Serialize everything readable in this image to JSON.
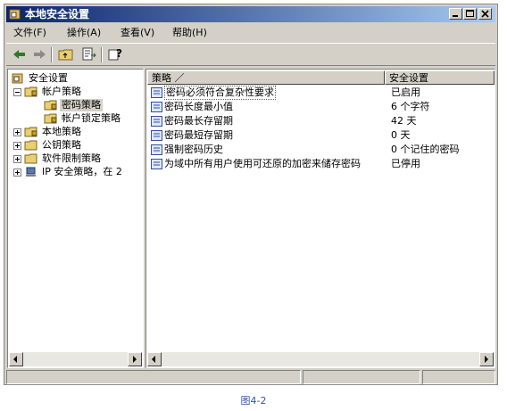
{
  "window": {
    "title": "本地安全设置"
  },
  "menu": [
    {
      "label": "文件(F)"
    },
    {
      "label": "操作(A)"
    },
    {
      "label": "查看(V)"
    },
    {
      "label": "帮助(H)"
    }
  ],
  "tree": [
    {
      "label": "安全设置"
    },
    {
      "label": "帐户策略"
    },
    {
      "label": "密码策略"
    },
    {
      "label": "帐户锁定策略"
    },
    {
      "label": "本地策略"
    },
    {
      "label": "公钥策略"
    },
    {
      "label": "软件限制策略"
    },
    {
      "label": "IP 安全策略，在 2"
    }
  ],
  "table": {
    "headers": [
      "策略 ／",
      "安全设置"
    ],
    "rows": [
      {
        "name": "密码必须符合复杂性要求",
        "value": "已启用"
      },
      {
        "name": "密码长度最小值",
        "value": "6 个字符"
      },
      {
        "name": "密码最长存留期",
        "value": "42 天"
      },
      {
        "name": "密码最短存留期",
        "value": "0 天"
      },
      {
        "name": "强制密码历史",
        "value": "0 个记住的密码"
      },
      {
        "name": "为域中所有用户使用可还原的加密来储存密码",
        "value": "已停用"
      }
    ]
  },
  "caption": "图4-2"
}
